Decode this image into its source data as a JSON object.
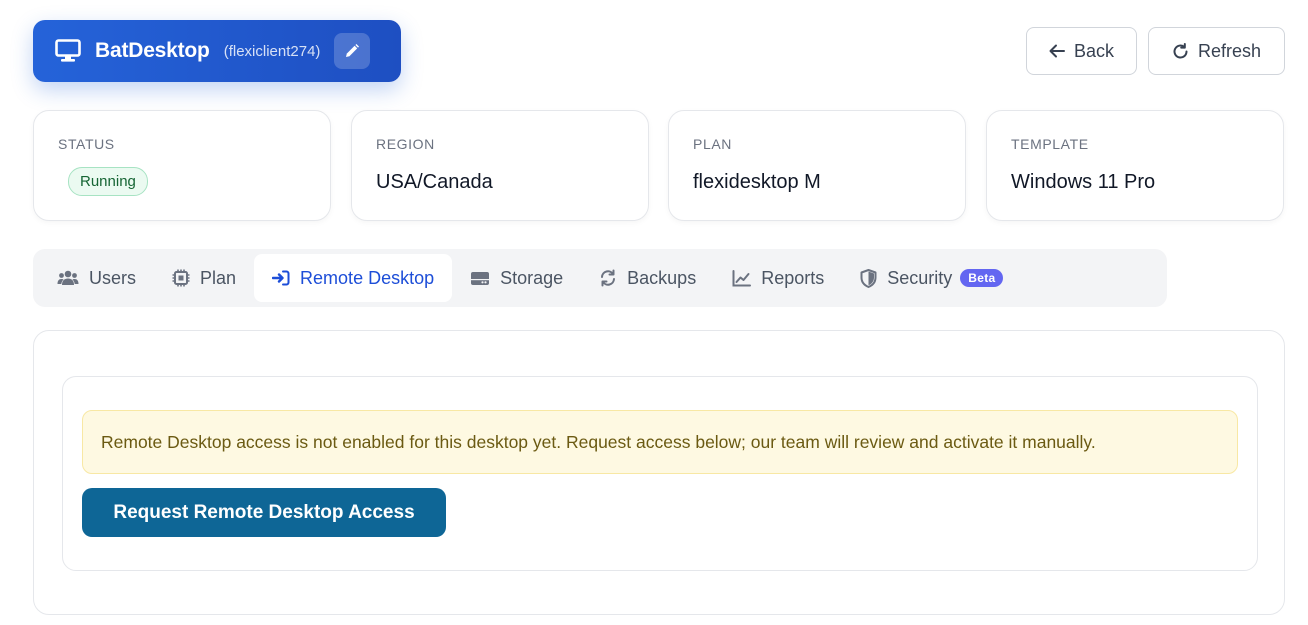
{
  "header": {
    "app_name": "BatDesktop",
    "client_id": "(flexiclient274)",
    "icon": "monitor-icon",
    "edit_icon": "pencil-icon",
    "accent_color": "#2563d9"
  },
  "actions": {
    "back_label": "Back",
    "refresh_label": "Refresh"
  },
  "cards": {
    "status": {
      "label": "Status",
      "value": "Running",
      "badge_color": "#166534"
    },
    "region": {
      "label": "Region",
      "value": "USA/Canada"
    },
    "plan": {
      "label": "Plan",
      "value": "flexidesktop M"
    },
    "template": {
      "label": "Template",
      "value": "Windows 11 Pro"
    }
  },
  "tabs": [
    {
      "label": "Users",
      "icon": "users-icon"
    },
    {
      "label": "Plan",
      "icon": "chip-icon"
    },
    {
      "label": "Remote Desktop",
      "icon": "sign-in-icon",
      "active": true
    },
    {
      "label": "Storage",
      "icon": "hard-drive-icon"
    },
    {
      "label": "Backups",
      "icon": "sync-icon"
    },
    {
      "label": "Reports",
      "icon": "line-chart-icon"
    },
    {
      "label": "Security",
      "icon": "shield-icon",
      "badge": "Beta"
    }
  ],
  "remote_desktop": {
    "notice": "Remote Desktop access is not enabled for this desktop yet. Request access below; our team will review and activate it manually.",
    "request_button_label": "Request Remote Desktop Access",
    "button_color": "#0e6696"
  }
}
